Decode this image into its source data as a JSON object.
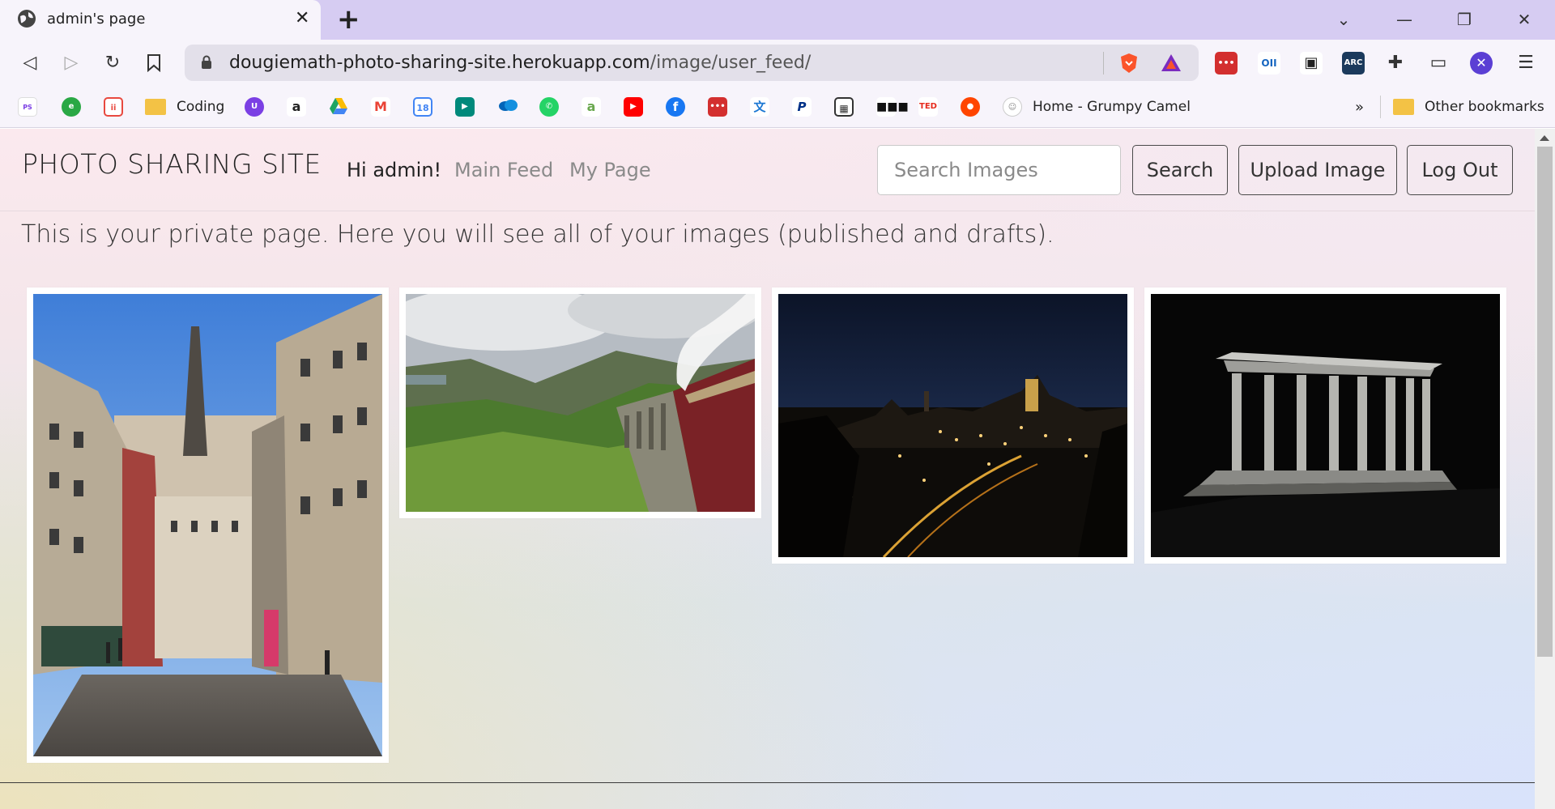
{
  "browser": {
    "tab_title": "admin's page",
    "url_host": "dougiemath-photo-sharing-site.herokuapp.com",
    "url_path": "/image/user_feed/",
    "bookmarks": [
      {
        "name": "Plain Spelling English",
        "icon": "ps-icon",
        "color": "#ffffff"
      },
      {
        "name": "globe-e",
        "icon": "e-icon",
        "color": "#2aa845"
      },
      {
        "name": "ii",
        "icon": "ii-icon",
        "color": "#e8493f"
      },
      {
        "name": "Coding",
        "icon": "folder-icon",
        "color": "#f3c245"
      },
      {
        "name": "u",
        "icon": "u-icon",
        "color": "#7b3fe4"
      },
      {
        "name": "amazon",
        "icon": "amazon-icon",
        "color": "#222"
      },
      {
        "name": "drive",
        "icon": "drive-icon",
        "color": "#1fa463"
      },
      {
        "name": "gmail",
        "icon": "gmail-icon",
        "color": "#ea4335"
      },
      {
        "name": "calendar",
        "icon": "calendar-icon",
        "color": "#4285f4"
      },
      {
        "name": "meet",
        "icon": "meet-icon",
        "color": "#00897b"
      },
      {
        "name": "onedrive",
        "icon": "cloud-icon",
        "color": "#0364b8"
      },
      {
        "name": "whatsapp",
        "icon": "whatsapp-icon",
        "color": "#25d366"
      },
      {
        "name": "a",
        "icon": "a-icon",
        "color": "#6aa84f"
      },
      {
        "name": "youtube",
        "icon": "youtube-icon",
        "color": "#ff0000"
      },
      {
        "name": "facebook",
        "icon": "facebook-icon",
        "color": "#1877f2"
      },
      {
        "name": "dots",
        "icon": "dots-icon",
        "color": "#d32f2f"
      },
      {
        "name": "translate",
        "icon": "translate-icon",
        "color": "#1976d2"
      },
      {
        "name": "paypal",
        "icon": "paypal-icon",
        "color": "#003087"
      },
      {
        "name": "qr",
        "icon": "qr-icon",
        "color": "#333333"
      },
      {
        "name": "more",
        "icon": "more-icon",
        "color": "#111111"
      },
      {
        "name": "TED",
        "icon": "ted-icon",
        "color": "#e62b1e"
      },
      {
        "name": "reddit",
        "icon": "reddit-icon",
        "color": "#ff4500"
      },
      {
        "name": "Home - Grumpy Camel",
        "icon": "camel-icon",
        "color": "#888888"
      }
    ],
    "bookmark_labels": {
      "coding": "Coding",
      "grumpy_camel": "Home - Grumpy Camel",
      "overflow": "»",
      "other": "Other bookmarks"
    },
    "extensions": [
      {
        "name": "brave-shields",
        "icon": "lion-icon",
        "color": "#fb542b"
      },
      {
        "name": "brave-rewards",
        "icon": "triangle-icon",
        "color": "#7b2cbf"
      },
      {
        "name": "ext-red",
        "icon": "dots-icon",
        "color": "#d32f2f",
        "text": "•••"
      },
      {
        "name": "ext-oii",
        "icon": "oii-icon",
        "color": "#1565c0",
        "text": "OII"
      },
      {
        "name": "ext-pip",
        "icon": "pip-icon",
        "color": "#222222",
        "text": "▣"
      },
      {
        "name": "ext-arc",
        "icon": "arc-icon",
        "color": "#1b3a5c",
        "text": "ARC"
      },
      {
        "name": "extensions",
        "icon": "puzzle-icon",
        "color": "#333333",
        "text": "✚"
      },
      {
        "name": "wallet",
        "icon": "wallet-icon",
        "color": "#333333",
        "text": "▭"
      },
      {
        "name": "profile",
        "icon": "profile-icon",
        "color": "#5b3fd4",
        "text": "✕"
      }
    ]
  },
  "site": {
    "brand": "PHOTO SHARING SITE",
    "greeting": "Hi admin!",
    "nav": {
      "main_feed": "Main Feed",
      "my_page": "My Page"
    },
    "search_placeholder": "Search Images",
    "buttons": {
      "search": "Search",
      "upload": "Upload Image",
      "logout": "Log Out"
    },
    "intro": "This is your private page. Here you will see all of your images (published and drafts).",
    "images": [
      {
        "name": "edinburgh-street-photo",
        "subject": "Victoria Street, colourful old buildings on a cobbled street"
      },
      {
        "name": "steam-train-viaduct-photo",
        "subject": "Steam train crossing a viaduct through green hills"
      },
      {
        "name": "city-night-skyline-photo",
        "subject": "City skyline at dusk with lit streets"
      },
      {
        "name": "national-monument-night-photo",
        "subject": "Illuminated colonnade monument at night"
      }
    ]
  }
}
